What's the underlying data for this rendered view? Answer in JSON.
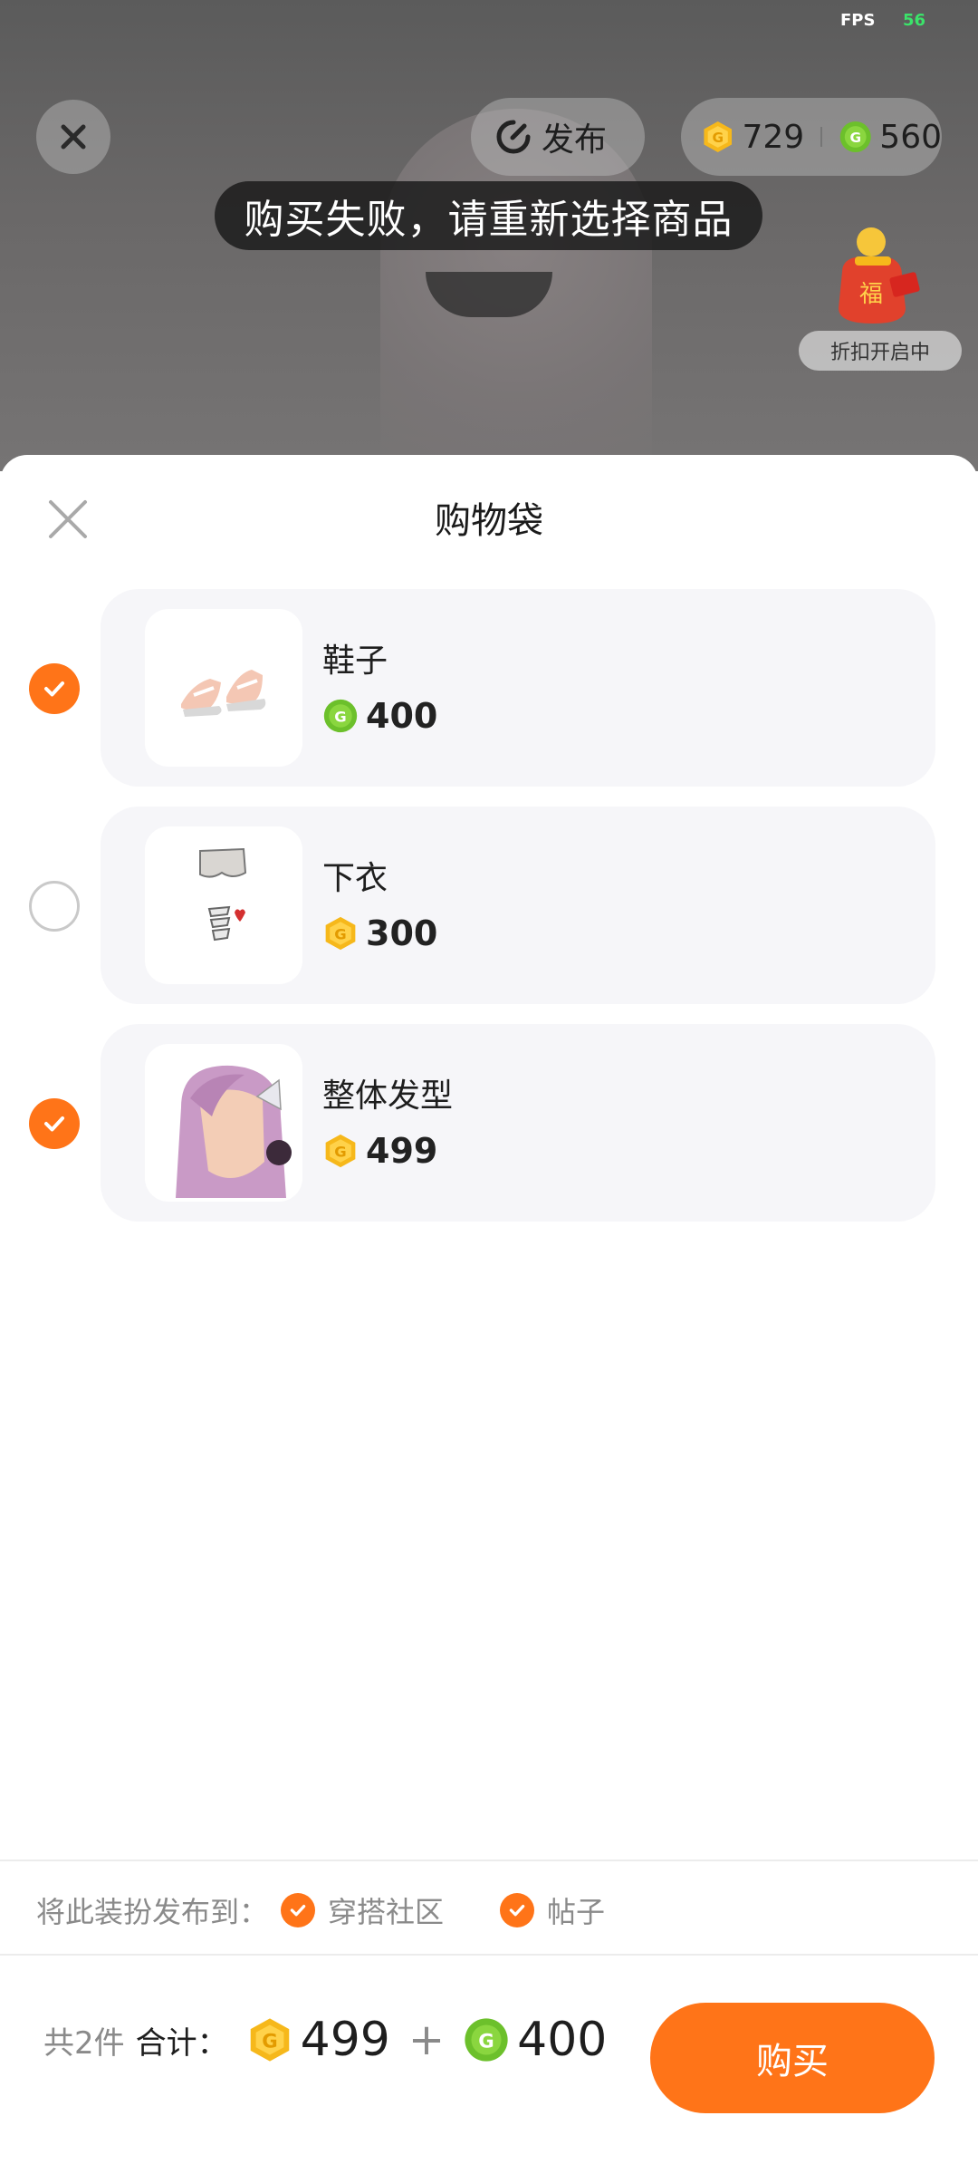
{
  "status": {
    "fps_label": "FPS",
    "fps_value": "56"
  },
  "top": {
    "publish_label": "发布",
    "gold_balance": "729",
    "green_balance": "560",
    "promo_label": "折扣开启中"
  },
  "toast": "购买失败，请重新选择商品",
  "sheet": {
    "title": "购物袋",
    "items": [
      {
        "name": "鞋子",
        "currency": "green",
        "price": "400",
        "selected": true
      },
      {
        "name": "下衣",
        "currency": "gold",
        "price": "300",
        "selected": false
      },
      {
        "name": "整体发型",
        "currency": "gold",
        "price": "499",
        "selected": true
      }
    ]
  },
  "publish_to": {
    "label": "将此装扮发布到：",
    "options": [
      "穿搭社区",
      "帖子"
    ]
  },
  "footer": {
    "count_text": "共2件",
    "total_label": "合计：",
    "gold_total": "499",
    "plus": "+",
    "green_total": "400",
    "buy_label": "购买"
  },
  "colors": {
    "accent": "#ff7418",
    "gold": "#f6b81b",
    "green": "#6cc02b"
  }
}
